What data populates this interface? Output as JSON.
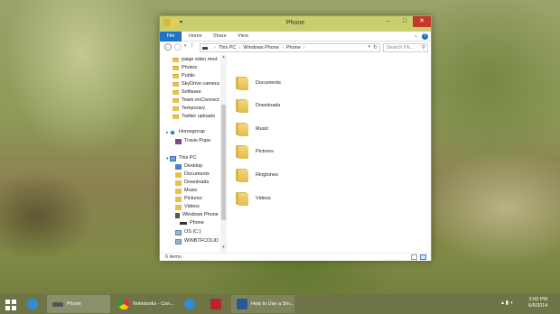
{
  "window": {
    "title": "Phone",
    "ribbon_tabs": [
      "File",
      "Home",
      "Share",
      "View"
    ],
    "help": "?"
  },
  "address": {
    "path": [
      "This PC",
      "Windows Phone",
      "Phone"
    ],
    "search_placeholder": "Search Ph..."
  },
  "nav_pane": {
    "folders": [
      "paige eden med",
      "Photos",
      "Public",
      "SkyDrive camera",
      "Software",
      "Team enConnect",
      "Temporary",
      "Twitter uploads"
    ],
    "homegroup": "Homegroup",
    "homegroup_user": "Travis Pope",
    "this_pc": "This PC",
    "pc_items": [
      "Desktop",
      "Documents",
      "Downloads",
      "Music",
      "Pictures",
      "Videos"
    ],
    "windows_phone": "Windows Phone",
    "phone": "Phone",
    "os_drive": "OS (C:)",
    "network_drive": "WINBTFCOLID"
  },
  "files": [
    "Documents",
    "Downloads",
    "Music",
    "Pictures",
    "Ringtones",
    "Videos"
  ],
  "status": {
    "count": "6 items"
  },
  "taskbar": {
    "explorer_label": "Phone",
    "chrome_label": "Notebooks - Con...",
    "word_label": "How to Use a Sm...",
    "time": "2:09 PM",
    "date": "6/6/2014"
  }
}
